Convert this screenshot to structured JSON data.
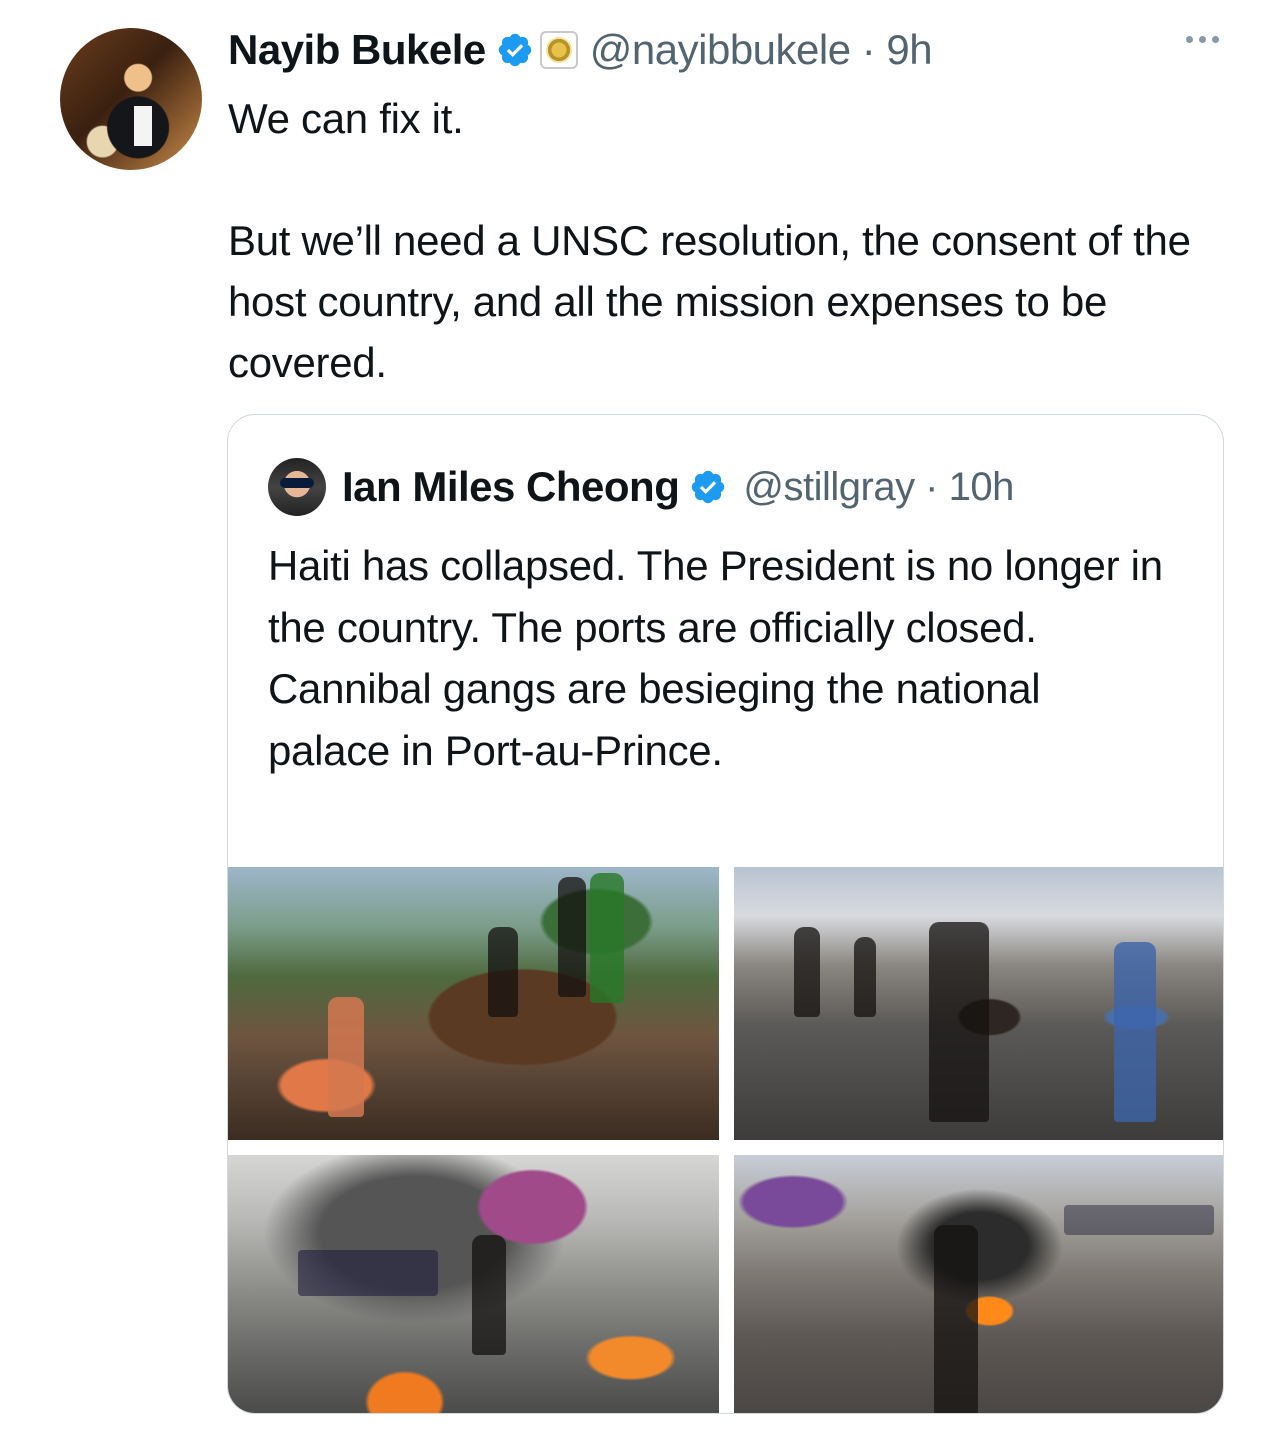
{
  "tweet": {
    "author_name": "Nayib Bukele",
    "handle_time": "@nayibbukele · 9h",
    "text_line1": "We can fix it.",
    "text_para2": "But we’ll need a UNSC resolution, the consent of the host country, and all the mission expenses to be covered."
  },
  "quote": {
    "author_name": "Ian Miles Cheong",
    "handle_time": "@stillgray · 10h",
    "text": "Haiti has collapsed. The President is no longer in the country. The ports are officially closed. Cannibal gangs are besieging the national palace in Port-au-Prince."
  },
  "icons": {
    "verified": "verified-badge-icon",
    "affiliate": "government-seal-icon",
    "more": "more-options-icon"
  },
  "colors": {
    "verified_blue": "#1d9bf0",
    "secondary_text": "#536471",
    "border": "#cfd9de"
  }
}
